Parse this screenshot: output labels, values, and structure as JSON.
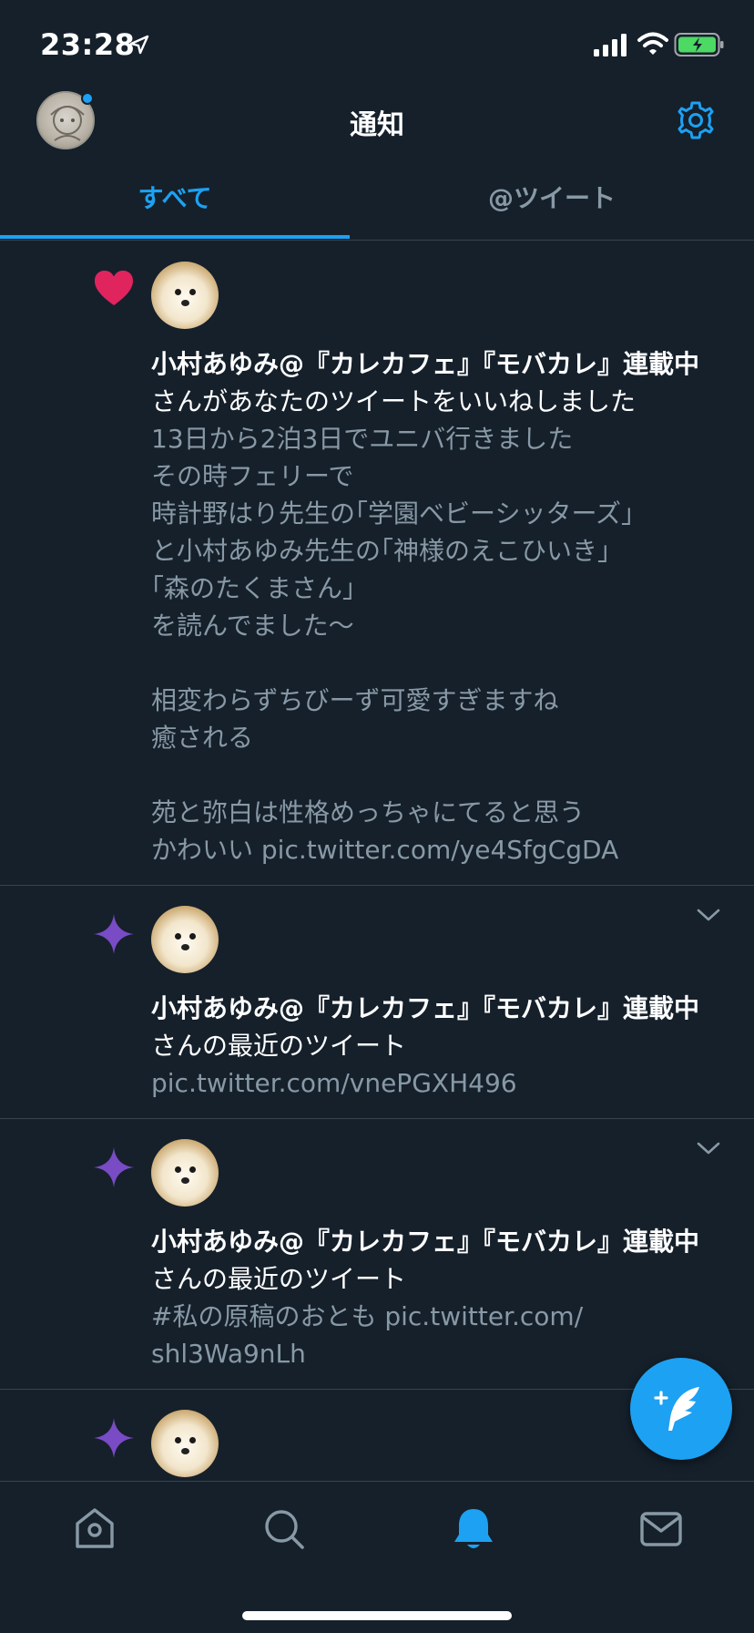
{
  "status_bar": {
    "time": "23:28"
  },
  "header": {
    "title": "通知"
  },
  "tabs": {
    "all": "すべて",
    "mentions": "@ツイート"
  },
  "notifications": [
    {
      "type": "like",
      "user": "小村あゆみ@『カレカフェ』『モバカレ』連載中",
      "action": "さんがあなたのツイートをいいねしました",
      "tweet": "13日から2泊3日でユニバ行きました\nその時フェリーで\n時計野はり先生の｢学園ベビーシッターズ｣\nと小村あゆみ先生の｢神様のえこひいき｣\n｢森のたくまさん｣\nを読んでました〜\n\n相変わらずちびーず可愛すぎますね\n癒される\n\n苑と弥白は性格めっちゃにてると思う\nかわいい pic.twitter.com/ye4SfgCgDA"
    },
    {
      "type": "recent",
      "user": "小村あゆみ@『カレカフェ』『モバカレ』連載中",
      "action": "さんの最近のツイート",
      "tweet": "pic.twitter.com/vnePGXH496"
    },
    {
      "type": "recent",
      "user": "小村あゆみ@『カレカフェ』『モバカレ』連載中",
      "action": "さんの最近のツイート",
      "tweet": "#私の原稿のおとも pic.twitter.com/\nshl3Wa9nLh"
    },
    {
      "type": "recent",
      "user": "",
      "action": "",
      "tweet": ""
    }
  ],
  "colors": {
    "background": "#15202b",
    "accent": "#1da1f2",
    "like": "#e0245e",
    "recent": "#794bc4",
    "secondary_text": "#8899a6",
    "divider": "#38444d"
  },
  "icons": {
    "like": "heart-icon",
    "recent": "sparkle-icon",
    "settings": "gear-icon",
    "compose": "compose-tweet-icon",
    "nav": [
      "home-icon",
      "search-icon",
      "bell-icon",
      "mail-icon"
    ]
  }
}
